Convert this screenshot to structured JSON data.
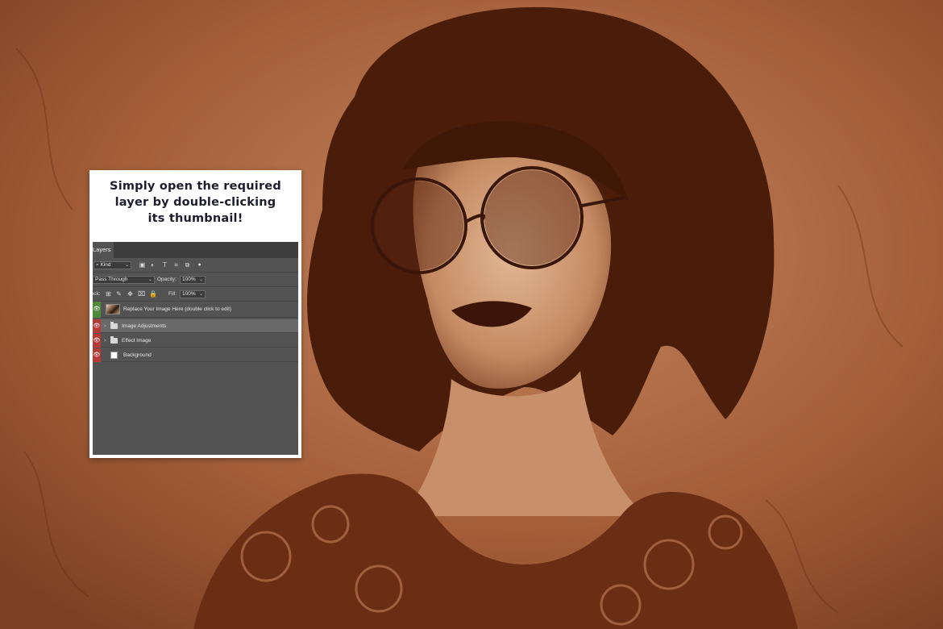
{
  "caption": {
    "line1": "Simply open the required",
    "line2": "layer by double-clicking",
    "line3": "its thumbnail!"
  },
  "layers_panel": {
    "tab_label": "Layers",
    "filter_kind": "Kind",
    "blend_mode": "Pass Through",
    "opacity_label": "Opacity:",
    "opacity_value": "100%",
    "lock_label": "Lock:",
    "fill_label": "Fill:",
    "fill_value": "100%",
    "filter_icons": [
      "image-filter-icon",
      "adjustment-filter-icon",
      "type-filter-icon",
      "shape-filter-icon",
      "smart-object-filter-icon",
      "filter-toggle-icon"
    ],
    "lock_icons": [
      "lock-transparent-icon",
      "lock-image-icon",
      "lock-position-icon",
      "lock-artboard-icon",
      "lock-all-icon"
    ],
    "layers": [
      {
        "name": "Replace Your Image Here (double click to edit)",
        "type": "smart-object",
        "visibility_color": "#4f8a3c",
        "selected": false
      },
      {
        "name": "Image Adjustments",
        "type": "group",
        "visibility_color": "#b73a36",
        "selected": true
      },
      {
        "name": "Effect Image",
        "type": "group",
        "visibility_color": "#b73a36",
        "selected": false
      },
      {
        "name": "Background",
        "type": "pixel",
        "visibility_color": "#b73a36",
        "selected": false
      }
    ]
  },
  "colors": {
    "background_sepia": "#9c5632",
    "card_bg": "#ffffff",
    "caption_text": "#1d1d2f",
    "panel_bg": "#535353"
  }
}
